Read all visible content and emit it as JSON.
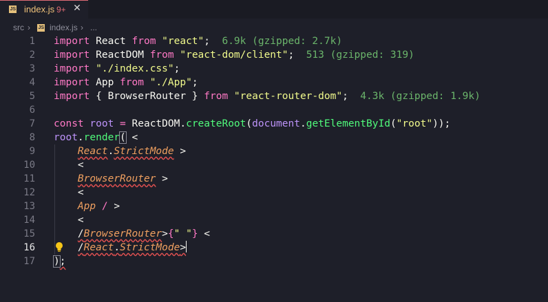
{
  "tab": {
    "icon": "js-file-icon",
    "icon_text": "JS",
    "filename": "index.js",
    "badge": "9+",
    "close": "✕"
  },
  "breadcrumb": {
    "folder": "src",
    "sep": "›",
    "file": "index.js",
    "more": "..."
  },
  "editor": {
    "active_line": 16,
    "line_numbers": [
      "1",
      "2",
      "3",
      "4",
      "5",
      "6",
      "7",
      "8",
      "9",
      "10",
      "11",
      "12",
      "13",
      "14",
      "15",
      "16",
      "17"
    ],
    "lines": [
      {
        "n": 1,
        "tokens": [
          [
            "kw",
            "import"
          ],
          [
            "",
            " React "
          ],
          [
            "kw",
            "from"
          ],
          [
            "",
            " "
          ],
          [
            "str",
            "\"react\""
          ],
          [
            "",
            ";  "
          ],
          [
            "hint",
            "6.9k (gzipped: 2.7k)"
          ]
        ]
      },
      {
        "n": 2,
        "tokens": [
          [
            "kw",
            "import"
          ],
          [
            "",
            " ReactDOM "
          ],
          [
            "kw",
            "from"
          ],
          [
            "",
            " "
          ],
          [
            "str",
            "\"react-dom/client\""
          ],
          [
            "",
            ";  "
          ],
          [
            "hint",
            "513 (gzipped: 319)"
          ]
        ]
      },
      {
        "n": 3,
        "tokens": [
          [
            "kw",
            "import"
          ],
          [
            "",
            " "
          ],
          [
            "str",
            "\"./index.css\""
          ],
          [
            "",
            ";"
          ]
        ]
      },
      {
        "n": 4,
        "tokens": [
          [
            "kw",
            "import"
          ],
          [
            "",
            " App "
          ],
          [
            "kw",
            "from"
          ],
          [
            "",
            " "
          ],
          [
            "str",
            "\"./App\""
          ],
          [
            "",
            ";"
          ]
        ]
      },
      {
        "n": 5,
        "tokens": [
          [
            "kw",
            "import"
          ],
          [
            "",
            " { BrowserRouter } "
          ],
          [
            "kw",
            "from"
          ],
          [
            "",
            " "
          ],
          [
            "str",
            "\"react-router-dom\""
          ],
          [
            "",
            ";  "
          ],
          [
            "hint",
            "4.3k (gzipped: 1.9k)"
          ]
        ]
      },
      {
        "n": 6,
        "tokens": []
      },
      {
        "n": 7,
        "tokens": [
          [
            "kw",
            "const"
          ],
          [
            "",
            " "
          ],
          [
            "var",
            "root"
          ],
          [
            "",
            " "
          ],
          [
            "kw",
            "="
          ],
          [
            "",
            " ReactDOM."
          ],
          [
            "fn",
            "createRoot"
          ],
          [
            "",
            "("
          ],
          [
            "var",
            "document"
          ],
          [
            "",
            "."
          ],
          [
            "fn",
            "getElementById"
          ],
          [
            "",
            "("
          ],
          [
            "str",
            "\"root\""
          ],
          [
            "",
            "));"
          ]
        ]
      },
      {
        "n": 8,
        "tokens": [
          [
            "var",
            "root"
          ],
          [
            "",
            "."
          ],
          [
            "fn",
            "render"
          ],
          [
            "box",
            "("
          ],
          [
            "",
            " <"
          ]
        ]
      },
      {
        "n": 9,
        "tokens": [
          [
            "",
            "    "
          ],
          [
            "cls wavy",
            "React"
          ],
          [
            "",
            "."
          ],
          [
            "cls wavy",
            "StrictMode"
          ],
          [
            "",
            " >"
          ]
        ]
      },
      {
        "n": 10,
        "tokens": [
          [
            "",
            "    <"
          ]
        ]
      },
      {
        "n": 11,
        "tokens": [
          [
            "",
            "    "
          ],
          [
            "cls wavy",
            "BrowserRouter"
          ],
          [
            "",
            " >"
          ]
        ]
      },
      {
        "n": 12,
        "tokens": [
          [
            "",
            "    <"
          ]
        ]
      },
      {
        "n": 13,
        "tokens": [
          [
            "",
            "    "
          ],
          [
            "cls",
            "App"
          ],
          [
            "",
            " "
          ],
          [
            "kw",
            "/"
          ],
          [
            "",
            " >"
          ]
        ]
      },
      {
        "n": 14,
        "tokens": [
          [
            "",
            "    <"
          ]
        ]
      },
      {
        "n": 15,
        "tokens": [
          [
            "",
            "    "
          ],
          [
            "wavy",
            "/"
          ],
          [
            "cls wavy",
            "BrowserRouter"
          ],
          [
            "",
            ">"
          ],
          [
            "kw",
            "{"
          ],
          [
            "str",
            "\" \""
          ],
          [
            "kw",
            "}"
          ],
          [
            "",
            " <"
          ]
        ]
      },
      {
        "n": 16,
        "tokens": [
          [
            "",
            "    "
          ],
          [
            "wavy",
            "/"
          ],
          [
            "cls wavy",
            "React"
          ],
          [
            "wavy",
            "."
          ],
          [
            "cls wavy",
            "StrictMode"
          ],
          [
            "wavy",
            ">"
          ],
          [
            "cursor",
            ""
          ]
        ]
      },
      {
        "n": 17,
        "tokens": [
          [
            "box",
            ")"
          ],
          [
            "wavy",
            ";"
          ]
        ]
      }
    ]
  },
  "lightbulb": {
    "icon": "lightbulb-icon",
    "color": "#f5c518"
  },
  "colors": {
    "background": "#1e1f29",
    "keyword": "#ff79c6",
    "string": "#f1fa8c",
    "function": "#50fa7b",
    "variable": "#bd93f9",
    "component": "#f0a060",
    "hint": "#6bb56b",
    "error_underline": "#e05050"
  }
}
